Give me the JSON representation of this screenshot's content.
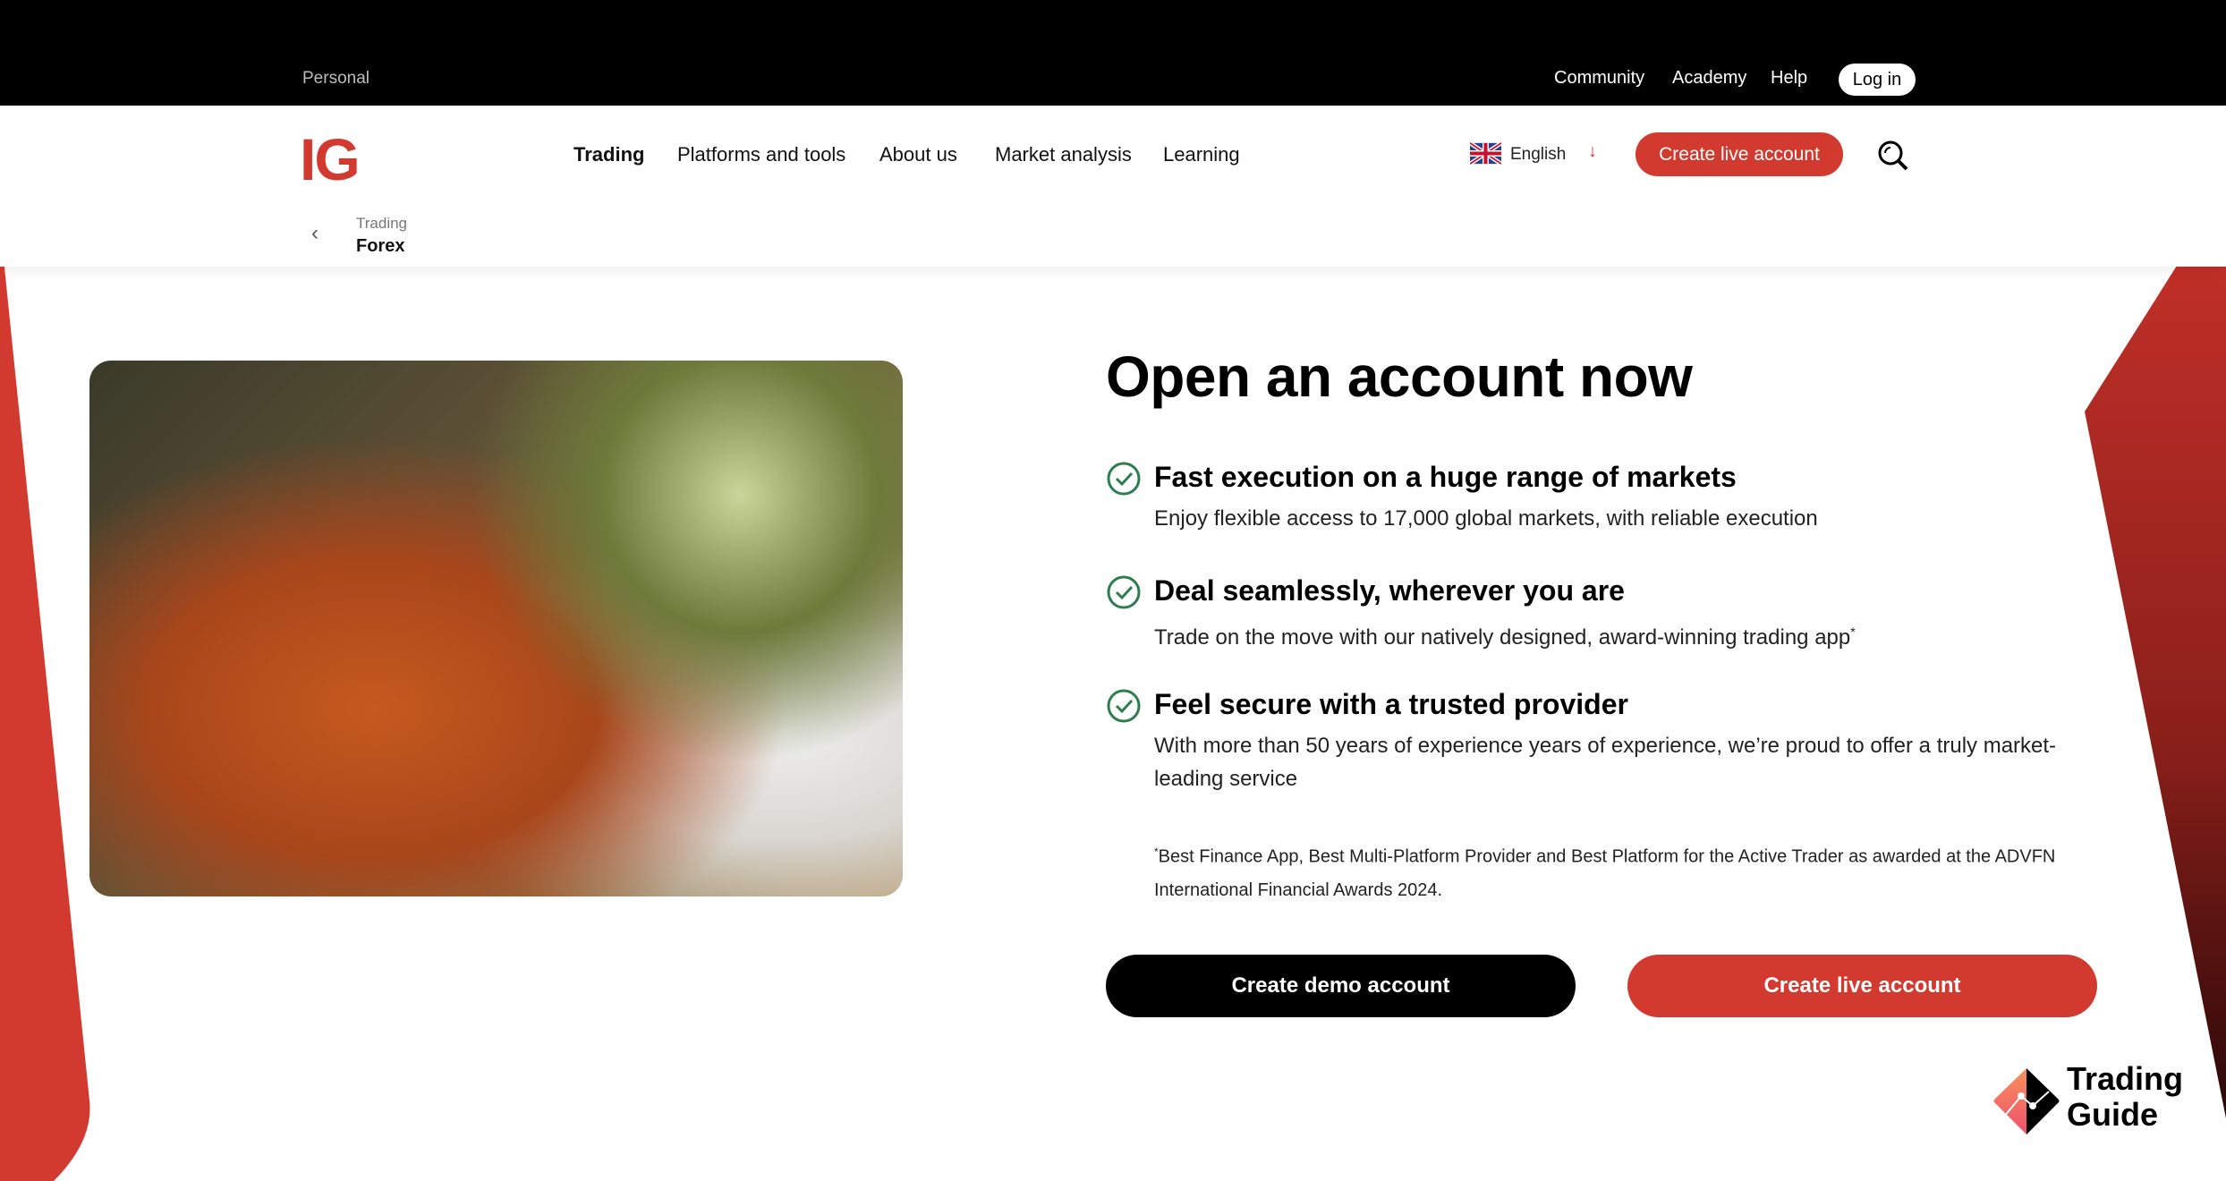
{
  "topbar": {
    "segment": "Personal",
    "links": [
      "Community",
      "Academy",
      "Help"
    ],
    "login": "Log in"
  },
  "header": {
    "logo": "IG",
    "nav": [
      "Trading",
      "Platforms and tools",
      "About us",
      "Market analysis",
      "Learning"
    ],
    "language": "English",
    "cta": "Create live account"
  },
  "breadcrumb": {
    "parent": "Trading",
    "current": "Forex"
  },
  "main": {
    "title": "Open an account now",
    "features": [
      {
        "title": "Fast execution on a huge range of markets",
        "desc": "Enjoy flexible access to 17,000 global markets, with reliable execution"
      },
      {
        "title": "Deal seamlessly, wherever you are",
        "desc": "Trade on the move with our natively designed, award-winning trading app",
        "sup": "*"
      },
      {
        "title": "Feel secure with a trusted provider",
        "desc": "With more than 50 years of experience years of experience, we’re proud to offer a truly market-leading service"
      }
    ],
    "footnote_mark": "*",
    "footnote": "Best Finance App, Best Multi-Platform Provider and Best Platform for the Active Trader as awarded at the ADVFN International Financial Awards 2024.",
    "demo_button": "Create demo account",
    "live_button": "Create live account"
  },
  "watermark": {
    "line1": "Trading",
    "line2": "Guide"
  },
  "colors": {
    "brand_red": "#d33a2f",
    "check_green": "#2e7d4f"
  }
}
